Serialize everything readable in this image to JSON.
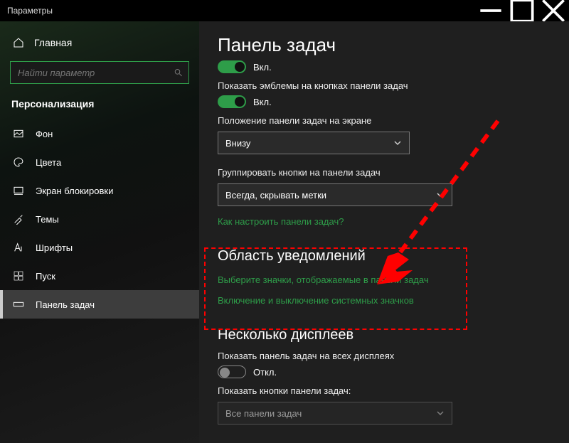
{
  "titlebar": {
    "title": "Параметры"
  },
  "sidebar": {
    "home": "Главная",
    "search_placeholder": "Найти параметр",
    "section": "Персонализация",
    "items": [
      {
        "label": "Фон"
      },
      {
        "label": "Цвета"
      },
      {
        "label": "Экран блокировки"
      },
      {
        "label": "Темы"
      },
      {
        "label": "Шрифты"
      },
      {
        "label": "Пуск"
      },
      {
        "label": "Панель задач"
      }
    ]
  },
  "content": {
    "heading": "Панель задач",
    "toggle1_state": "Вкл.",
    "emblems_label": "Показать эмблемы на кнопках панели задач",
    "toggle2_state": "Вкл.",
    "position_label": "Положение панели задач на экране",
    "position_value": "Внизу",
    "group_label": "Группировать кнопки на панели задач",
    "group_value": "Всегда, скрывать метки",
    "help_link": "Как настроить панели задач?",
    "notif_heading": "Область уведомлений",
    "notif_link1": "Выберите значки, отображаемые в панели задач",
    "notif_link2": "Включение и выключение системных значков",
    "multi_heading": "Несколько дисплеев",
    "multi_label": "Показать панель задач на всех дисплеях",
    "toggle3_state": "Откл.",
    "multi_buttons_label": "Показать кнопки панели задач:",
    "multi_buttons_value": "Все панели задач"
  }
}
